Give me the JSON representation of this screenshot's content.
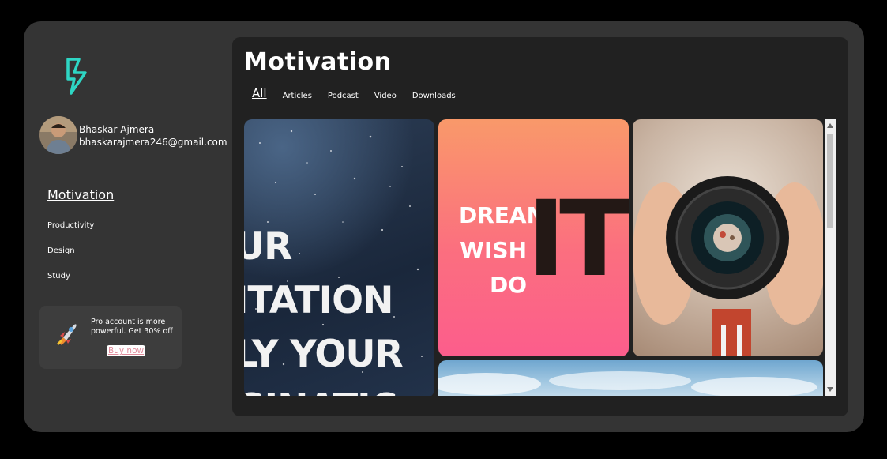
{
  "user": {
    "name": "Bhaskar Ajmera",
    "email": "bhaskarajmera246@gmail.com"
  },
  "sidebar": {
    "items": [
      {
        "label": "Motivation",
        "active": true
      },
      {
        "label": "Productivity",
        "active": false
      },
      {
        "label": "Design",
        "active": false
      },
      {
        "label": "Study",
        "active": false
      }
    ]
  },
  "promo": {
    "text": "Pro account is more powerful. Get 30% off",
    "button": "Buy now",
    "icon": "rocket-icon"
  },
  "main": {
    "title": "Motivation",
    "tabs": [
      {
        "label": "All",
        "active": true
      },
      {
        "label": "Articles",
        "active": false
      },
      {
        "label": "Podcast",
        "active": false
      },
      {
        "label": "Video",
        "active": false
      },
      {
        "label": "Downloads",
        "active": false
      }
    ]
  },
  "cards": {
    "card1_lines": [
      "UR",
      "ITATION",
      "LY YOUR",
      "GINATIC"
    ],
    "card2_left": [
      "DREAM",
      "WISH",
      "DO"
    ],
    "card2_right": "IT"
  },
  "colors": {
    "accent": "#2ed6c4",
    "app_bg": "#343434",
    "main_bg": "#212121",
    "buy_now": "#e08a9a"
  }
}
